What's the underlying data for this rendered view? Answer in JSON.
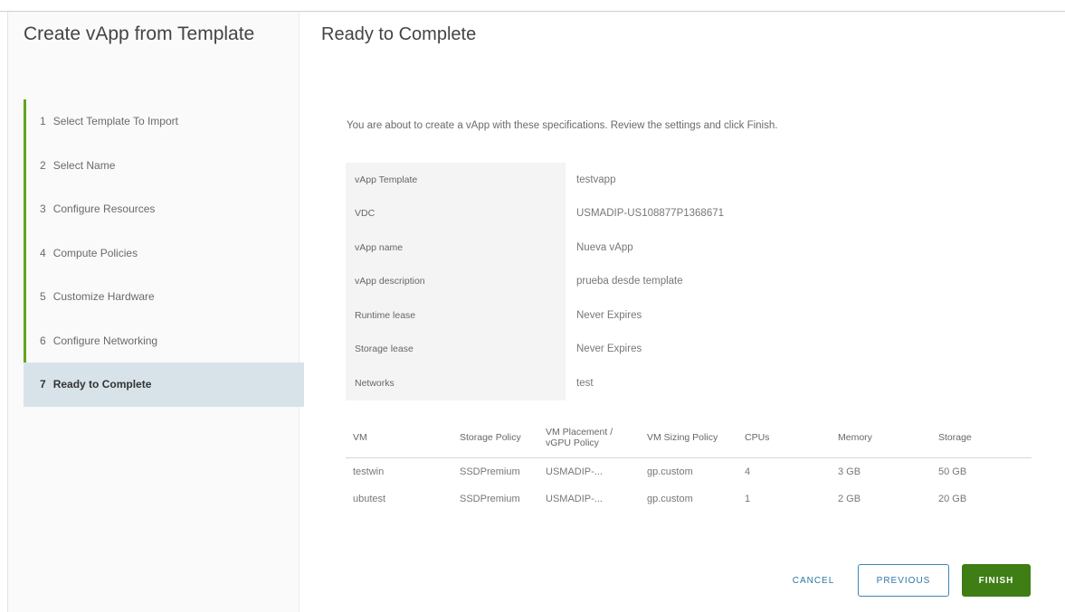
{
  "wizard": {
    "title": "Create vApp from Template",
    "steps": [
      {
        "num": "1",
        "label": "Select Template To Import"
      },
      {
        "num": "2",
        "label": "Select Name"
      },
      {
        "num": "3",
        "label": "Configure Resources"
      },
      {
        "num": "4",
        "label": "Compute Policies"
      },
      {
        "num": "5",
        "label": "Customize Hardware"
      },
      {
        "num": "6",
        "label": "Configure Networking"
      },
      {
        "num": "7",
        "label": "Ready to Complete"
      }
    ],
    "active_step": 7
  },
  "page": {
    "title": "Ready to Complete",
    "intro": "You are about to create a vApp with these specifications. Review the settings and click Finish."
  },
  "spec": [
    {
      "key": "vApp Template",
      "value": "testvapp"
    },
    {
      "key": "VDC",
      "value": "USMADIP-US108877P1368671"
    },
    {
      "key": "vApp name",
      "value": "Nueva vApp"
    },
    {
      "key": "vApp description",
      "value": "prueba desde template"
    },
    {
      "key": "Runtime lease",
      "value": "Never Expires"
    },
    {
      "key": "Storage lease",
      "value": "Never Expires"
    },
    {
      "key": "Networks",
      "value": "test"
    }
  ],
  "vm_table": {
    "headers": [
      "VM",
      "Storage Policy",
      "VM Placement / vGPU Policy",
      "VM Sizing Policy",
      "CPUs",
      "Memory",
      "Storage"
    ],
    "rows": [
      [
        "testwin",
        "SSDPremium",
        "USMADIP-...",
        "gp.custom",
        "4",
        "3 GB",
        "50 GB"
      ],
      [
        "ubutest",
        "SSDPremium",
        "USMADIP-...",
        "gp.custom",
        "1",
        "2 GB",
        "20 GB"
      ]
    ]
  },
  "buttons": {
    "cancel": "CANCEL",
    "previous": "PREVIOUS",
    "finish": "FINISH"
  },
  "colors": {
    "step_done_bar": "#62a420",
    "active_step_bg": "#d8e3e9",
    "finish_bg": "#3f7d15",
    "link_blue": "#2e77a6"
  }
}
